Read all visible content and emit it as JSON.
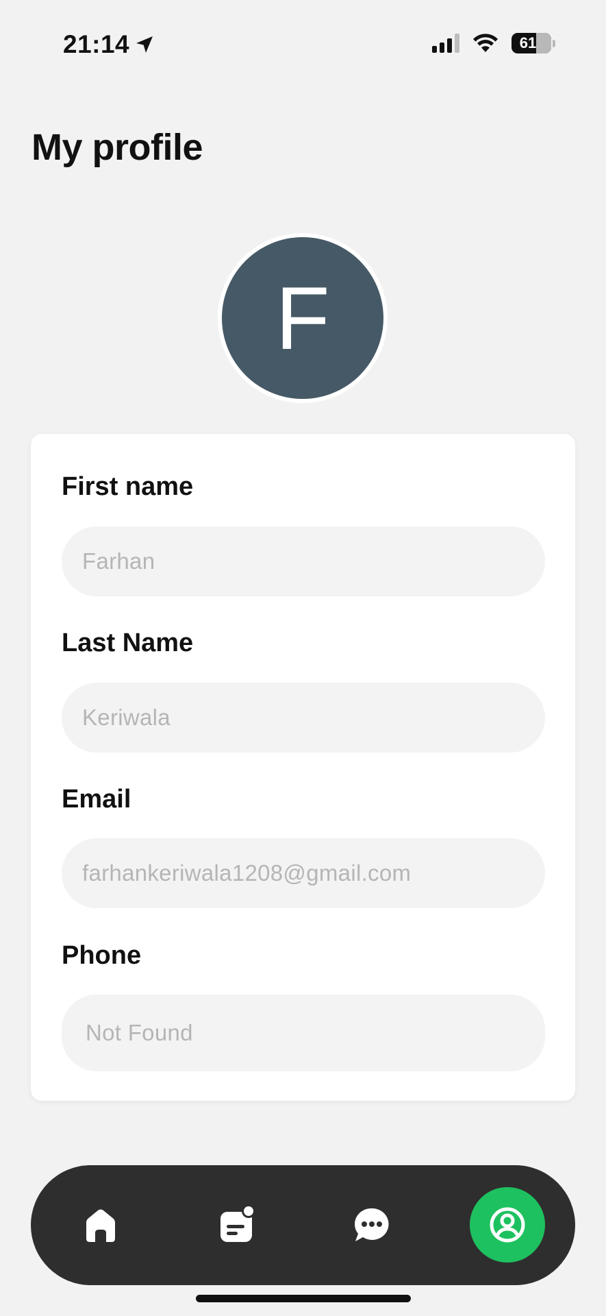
{
  "status_bar": {
    "time": "21:14",
    "battery": "61",
    "location_icon": "location-arrow-icon",
    "signal_icon": "cellular-signal-icon",
    "wifi_icon": "wifi-icon"
  },
  "page": {
    "title": "My profile"
  },
  "avatar": {
    "initial": "F",
    "color": "#465966"
  },
  "form": {
    "first_name": {
      "label": "First name",
      "value": "Farhan"
    },
    "last_name": {
      "label": "Last Name",
      "value": "Keriwala"
    },
    "email": {
      "label": "Email",
      "value": "farhankeriwala1208@gmail.com"
    },
    "phone": {
      "label": "Phone",
      "value": "Not Found"
    }
  },
  "bottom_nav": {
    "items": [
      {
        "icon": "home-icon",
        "active": false
      },
      {
        "icon": "document-icon",
        "active": false
      },
      {
        "icon": "chat-bubble-icon",
        "active": false
      },
      {
        "icon": "profile-icon",
        "active": true
      }
    ],
    "active_color": "#1ec15f",
    "background": "#2e2e2e"
  }
}
